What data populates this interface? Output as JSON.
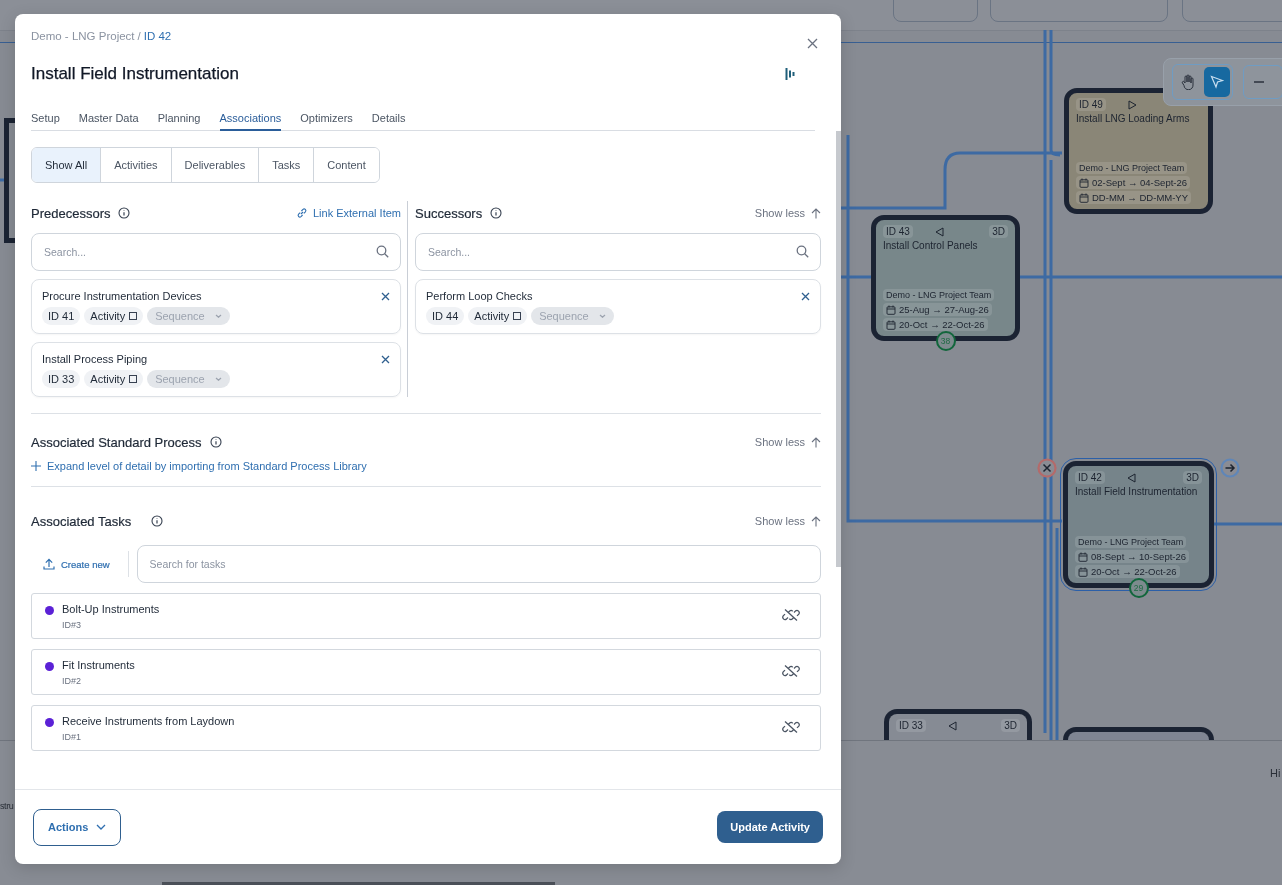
{
  "canvas": {
    "nodes": [
      {
        "id": "ID 49",
        "kind": "right",
        "title": "Install LNG Loading Arms",
        "team": "Demo - LNG Project Team",
        "planned": "02-Sept → 04-Sept-26",
        "actual": "DD-MM → DD-MM-YY",
        "color": "#8a8677",
        "selected": false
      },
      {
        "id": "ID 43",
        "kind": "left",
        "duration": "3D",
        "title": "Install Control Panels",
        "team": "Demo - LNG Project Team",
        "planned": "25-Aug → 27-Aug-26",
        "actual": "20-Oct → 22-Oct-26",
        "badge": "38",
        "color": "#78878a",
        "selected": false
      },
      {
        "id": "ID 42",
        "kind": "left",
        "duration": "3D",
        "title": "Install Field Instrumentation",
        "team": "Demo - LNG Project Team",
        "planned": "08-Sept → 10-Sept-26",
        "actual": "20-Oct → 22-Oct-26",
        "badge": "29",
        "color": "#76848a",
        "selected": true
      },
      {
        "id": "ID 33",
        "kind": "left",
        "duration": "3D",
        "color": "#868b94",
        "selected": false
      }
    ],
    "tools": [
      {
        "kind": "hand",
        "selected": false
      },
      {
        "kind": "pointer",
        "selected": true
      }
    ],
    "side_text": "Hi",
    "left_text": "stru"
  },
  "modal": {
    "breadcrumb": [
      {
        "label": "Demo - LNG Project",
        "current": false
      },
      {
        "label": "ID 42",
        "current": true
      }
    ],
    "separator": "/",
    "title": "Install Field Instrumentation",
    "tabs": [
      {
        "label": "Setup",
        "selected": false
      },
      {
        "label": "Master Data",
        "selected": false
      },
      {
        "label": "Planning",
        "selected": false
      },
      {
        "label": "Associations",
        "selected": true
      },
      {
        "label": "Optimizers",
        "selected": false
      },
      {
        "label": "Details",
        "selected": false
      }
    ],
    "filters": [
      {
        "label": "Show All",
        "selected": true
      },
      {
        "label": "Activities",
        "selected": false
      },
      {
        "label": "Deliverables",
        "selected": false
      },
      {
        "label": "Tasks",
        "selected": false
      },
      {
        "label": "Content",
        "selected": false
      }
    ],
    "predecessors": {
      "title": "Predecessors",
      "link": "Link External Item",
      "placeholder": "Search...",
      "items": [
        {
          "name": "Procure Instrumentation Devices",
          "id": "ID 41",
          "type": "Activity",
          "checked": false,
          "sequence": "Sequence"
        },
        {
          "name": "Install Process Piping",
          "id": "ID 33",
          "type": "Activity",
          "checked": false,
          "sequence": "Sequence"
        }
      ]
    },
    "successors": {
      "title": "Successors",
      "toggle": "Show less",
      "placeholder": "Search...",
      "items": [
        {
          "name": "Perform Loop Checks",
          "id": "ID 44",
          "type": "Activity",
          "checked": false,
          "sequence": "Sequence"
        }
      ]
    },
    "standard_process": {
      "title": "Associated Standard Process",
      "toggle": "Show less",
      "action": "Expand level of detail by importing from Standard Process Library"
    },
    "tasks": {
      "title": "Associated Tasks",
      "toggle": "Show less",
      "create": "Create new",
      "placeholder": "Search for tasks",
      "items": [
        {
          "name": "Bolt-Up Instruments",
          "id": "ID#3",
          "color": "#5b21d6"
        },
        {
          "name": "Fit Instruments",
          "id": "ID#2",
          "color": "#5b21d6"
        },
        {
          "name": "Receive Instruments from Laydown",
          "id": "ID#1",
          "color": "#5b21d6"
        }
      ]
    },
    "footer": {
      "actions": "Actions",
      "primary": "Update Activity"
    }
  }
}
